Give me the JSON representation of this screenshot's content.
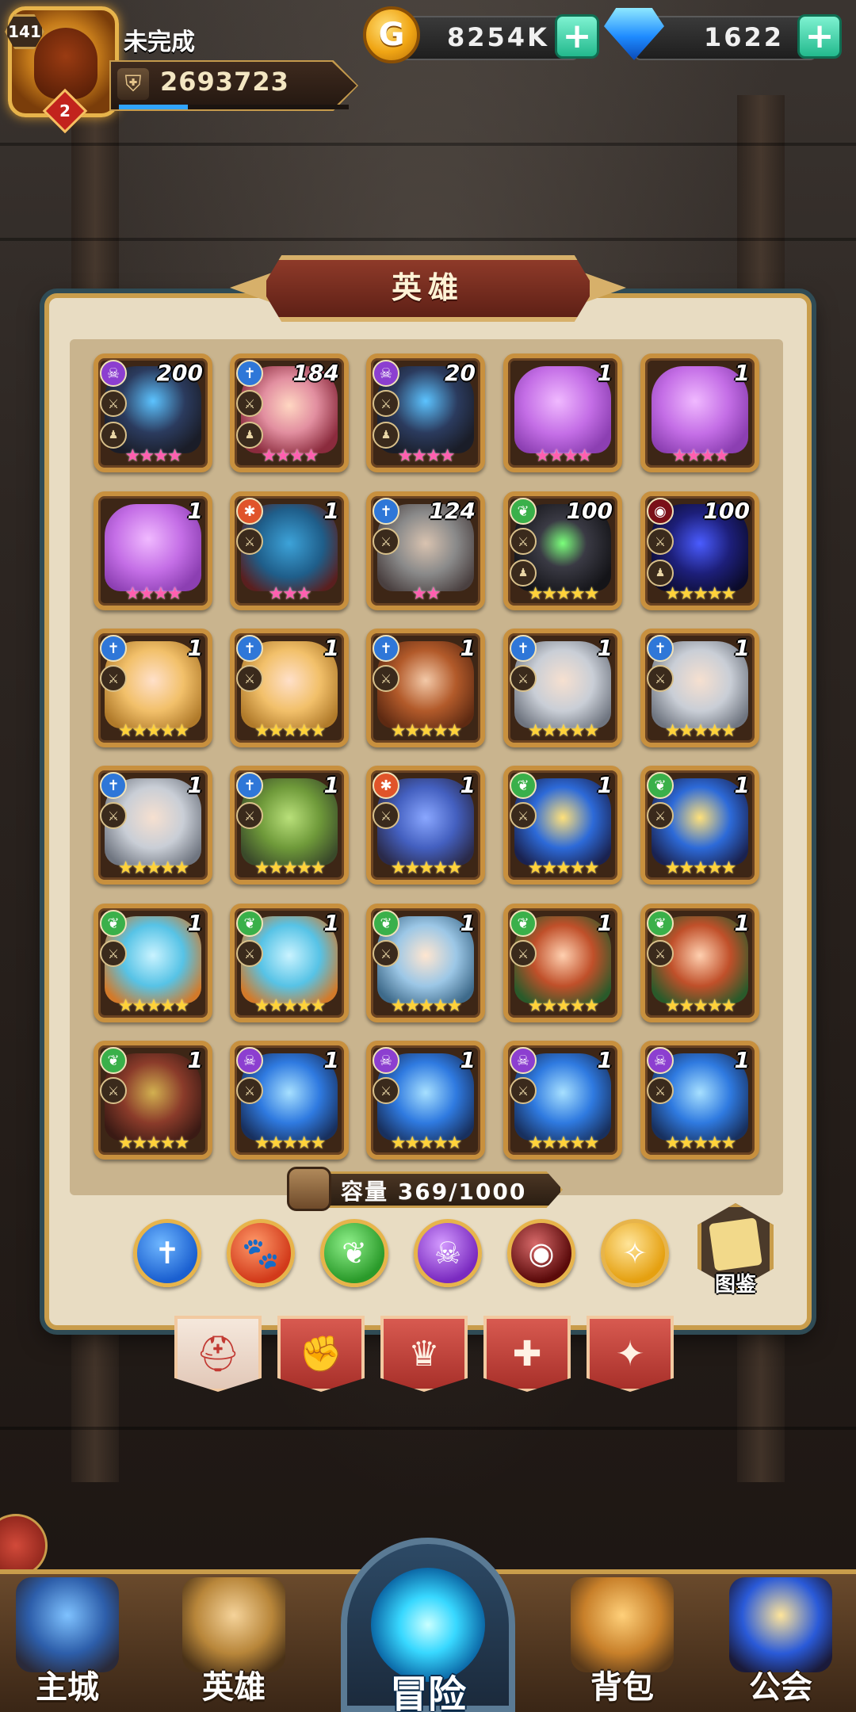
{
  "player": {
    "level": "141",
    "rank": "2",
    "name": "未完成",
    "power": "2693723",
    "xp_fraction": 0.3
  },
  "resources": {
    "gold": "8254K",
    "gems": "1622"
  },
  "panel": {
    "title": "英雄",
    "capacity_label": "容量",
    "capacity_value": "369/1000",
    "codex_label": "图鉴"
  },
  "filters": [
    {
      "name": "holy",
      "glyph": "✝"
    },
    {
      "name": "beast",
      "glyph": "🐾"
    },
    {
      "name": "nature",
      "glyph": "❦"
    },
    {
      "name": "shadow",
      "glyph": "☠"
    },
    {
      "name": "abyss",
      "glyph": "◉"
    },
    {
      "name": "light",
      "glyph": "✧"
    }
  ],
  "category_tabs": [
    "helmet",
    "fist",
    "crown",
    "puzzle",
    "wings"
  ],
  "heroes": [
    {
      "count": "200",
      "faction": "shadow",
      "stars": 4,
      "star_color": "pink",
      "portrait": "reaper",
      "group": true
    },
    {
      "count": "184",
      "faction": "holy",
      "stars": 4,
      "star_color": "pink",
      "portrait": "elf",
      "group": true
    },
    {
      "count": "20",
      "faction": "shadow",
      "stars": 4,
      "star_color": "pink",
      "portrait": "reaper",
      "group": true
    },
    {
      "count": "1",
      "faction": "none",
      "stars": 4,
      "star_color": "pink",
      "portrait": "slime",
      "group": false
    },
    {
      "count": "1",
      "faction": "none",
      "stars": 4,
      "star_color": "pink",
      "portrait": "slime",
      "group": false
    },
    {
      "count": "1",
      "faction": "none",
      "stars": 4,
      "star_color": "pink",
      "portrait": "slime",
      "group": false
    },
    {
      "count": "1",
      "faction": "beast",
      "stars": 3,
      "star_color": "pink",
      "portrait": "orc",
      "group": false
    },
    {
      "count": "124",
      "faction": "holy",
      "stars": 2,
      "star_color": "pink",
      "portrait": "dwarf",
      "group": false
    },
    {
      "count": "100",
      "faction": "nature",
      "stars": 5,
      "star_color": "gold",
      "portrait": "dark",
      "group": true
    },
    {
      "count": "100",
      "faction": "abyss",
      "stars": 5,
      "star_color": "gold",
      "portrait": "demon",
      "group": true
    },
    {
      "count": "1",
      "faction": "holy",
      "stars": 5,
      "star_color": "gold",
      "portrait": "valk",
      "group": false
    },
    {
      "count": "1",
      "faction": "holy",
      "stars": 5,
      "star_color": "gold",
      "portrait": "valk",
      "group": false
    },
    {
      "count": "1",
      "faction": "holy",
      "stars": 5,
      "star_color": "gold",
      "portrait": "beard",
      "group": false
    },
    {
      "count": "1",
      "faction": "holy",
      "stars": 5,
      "star_color": "gold",
      "portrait": "knight",
      "group": false
    },
    {
      "count": "1",
      "faction": "holy",
      "stars": 5,
      "star_color": "gold",
      "portrait": "knight",
      "group": false
    },
    {
      "count": "1",
      "faction": "holy",
      "stars": 5,
      "star_color": "gold",
      "portrait": "knight",
      "group": false
    },
    {
      "count": "1",
      "faction": "holy",
      "stars": 5,
      "star_color": "gold",
      "portrait": "goblin",
      "group": false
    },
    {
      "count": "1",
      "faction": "beast",
      "stars": 5,
      "star_color": "gold",
      "portrait": "ogre",
      "group": false
    },
    {
      "count": "1",
      "faction": "nature",
      "stars": 5,
      "star_color": "gold",
      "portrait": "anubis",
      "group": false
    },
    {
      "count": "1",
      "faction": "nature",
      "stars": 5,
      "star_color": "gold",
      "portrait": "anubis",
      "group": false
    },
    {
      "count": "1",
      "faction": "nature",
      "stars": 5,
      "star_color": "gold",
      "portrait": "dragon",
      "group": false
    },
    {
      "count": "1",
      "faction": "nature",
      "stars": 5,
      "star_color": "gold",
      "portrait": "dragon",
      "group": false
    },
    {
      "count": "1",
      "faction": "nature",
      "stars": 5,
      "star_color": "gold",
      "portrait": "silver",
      "group": false
    },
    {
      "count": "1",
      "faction": "nature",
      "stars": 5,
      "star_color": "gold",
      "portrait": "ranger",
      "group": false
    },
    {
      "count": "1",
      "faction": "nature",
      "stars": 5,
      "star_color": "gold",
      "portrait": "ranger",
      "group": false
    },
    {
      "count": "1",
      "faction": "nature",
      "stars": 5,
      "star_color": "gold",
      "portrait": "brute",
      "group": false
    },
    {
      "count": "1",
      "faction": "shadow",
      "stars": 5,
      "star_color": "gold",
      "portrait": "wolf",
      "group": false
    },
    {
      "count": "1",
      "faction": "shadow",
      "stars": 5,
      "star_color": "gold",
      "portrait": "wolf",
      "group": false
    },
    {
      "count": "1",
      "faction": "shadow",
      "stars": 5,
      "star_color": "gold",
      "portrait": "wolf",
      "group": false
    },
    {
      "count": "1",
      "faction": "shadow",
      "stars": 5,
      "star_color": "gold",
      "portrait": "wolf",
      "group": false
    }
  ],
  "nav": {
    "city": "主城",
    "hero": "英雄",
    "adventure": "冒险",
    "bag": "背包",
    "guild": "公会"
  }
}
